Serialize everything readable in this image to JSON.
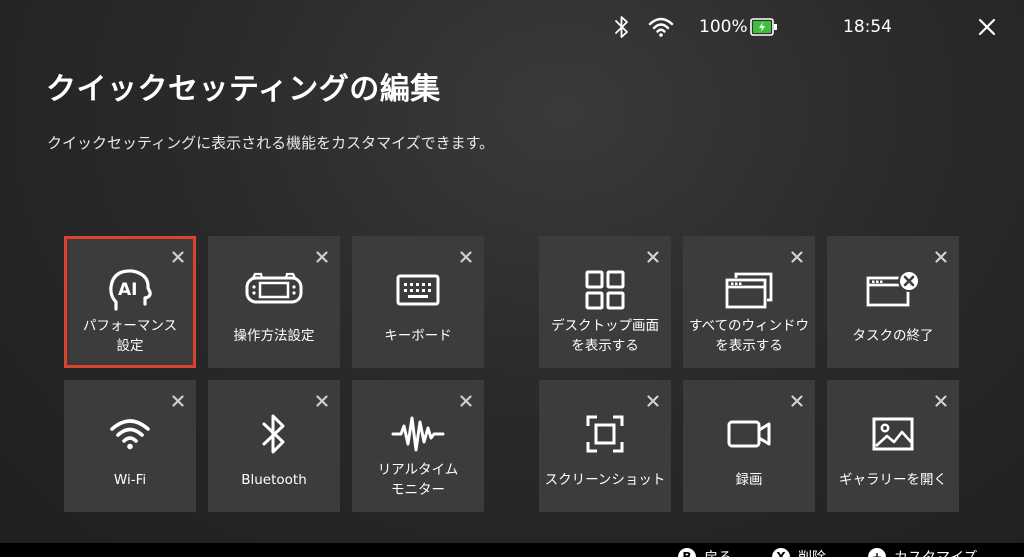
{
  "status": {
    "battery_percent": "100%",
    "time": "18:54"
  },
  "page": {
    "title": "クイックセッティングの編集",
    "subtitle": "クイックセッティングに表示される機能をカスタマイズできます。"
  },
  "tiles": [
    {
      "label": "パフォーマンス\n設定",
      "icon": "ai-head-icon",
      "selected": true
    },
    {
      "label": "操作方法設定",
      "icon": "handheld-device-icon"
    },
    {
      "label": "キーボード",
      "icon": "keyboard-icon"
    },
    {
      "label": "デスクトップ画面\nを表示する",
      "icon": "desktop-grid-icon"
    },
    {
      "label": "すべてのウィンドウ\nを表示する",
      "icon": "windows-stack-icon"
    },
    {
      "label": "タスクの終了",
      "icon": "end-task-icon"
    },
    {
      "label": "Wi-Fi",
      "icon": "wifi-icon"
    },
    {
      "label": "Bluetooth",
      "icon": "bluetooth-icon"
    },
    {
      "label": "リアルタイム\nモニター",
      "icon": "waveform-icon"
    },
    {
      "label": "スクリーンショット",
      "icon": "screenshot-icon"
    },
    {
      "label": "録画",
      "icon": "video-camera-icon"
    },
    {
      "label": "ギャラリーを開く",
      "icon": "gallery-icon"
    }
  ],
  "bottom_hints": [
    {
      "key": "B",
      "label": "戻る"
    },
    {
      "key": "X",
      "label": "削除"
    },
    {
      "key": "+",
      "label": "カスタマイズ"
    }
  ],
  "colors": {
    "selection_border": "#d9432f",
    "tile_bg": "#3c3c3c",
    "battery_fill": "#3fbf3f"
  }
}
